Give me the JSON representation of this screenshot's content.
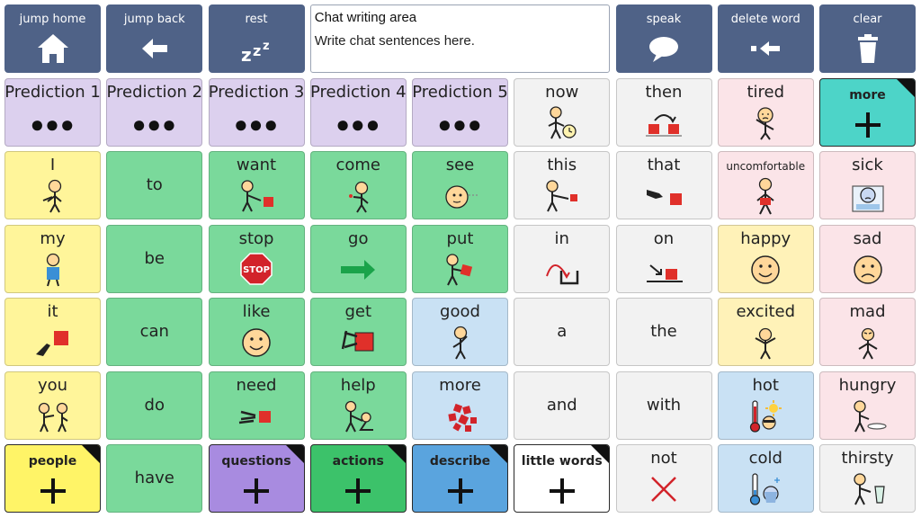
{
  "topbar": {
    "jump_home": "jump home",
    "jump_back": "jump back",
    "rest": "rest",
    "chat_title": "Chat writing area",
    "chat_placeholder": "Write chat sentences here.",
    "speak": "speak",
    "delete_word": "delete word",
    "clear": "clear"
  },
  "predictions": [
    "Prediction 1",
    "Prediction 2",
    "Prediction 3",
    "Prediction 4",
    "Prediction 5"
  ],
  "prediction_dots": "●●●",
  "words": {
    "now": "now",
    "then": "then",
    "tired": "tired",
    "more_top": "more",
    "I": "I",
    "to": "to",
    "want": "want",
    "come": "come",
    "see": "see",
    "this": "this",
    "that": "that",
    "uncomfortable": "uncomfortable",
    "sick": "sick",
    "my": "my",
    "be": "be",
    "stop": "stop",
    "go": "go",
    "put": "put",
    "in": "in",
    "on": "on",
    "happy": "happy",
    "sad": "sad",
    "it": "it",
    "can": "can",
    "like": "like",
    "get": "get",
    "good": "good",
    "a": "a",
    "the": "the",
    "excited": "excited",
    "mad": "mad",
    "you": "you",
    "do": "do",
    "need": "need",
    "help": "help",
    "more": "more",
    "and": "and",
    "with": "with",
    "hot": "hot",
    "hungry": "hungry",
    "people": "people",
    "have": "have",
    "questions": "questions",
    "actions": "actions",
    "describe": "describe",
    "little_words": "little words",
    "not": "not",
    "cold": "cold",
    "thirsty": "thirsty"
  },
  "stop_sign_text": "STOP",
  "colors": {
    "nav": "#4f6287",
    "prediction": "#dcd0ee",
    "pronoun": "#fff59a",
    "verb": "#7ad99b",
    "little_word": "#f2f2f2",
    "feeling_neg": "#fbe4e8",
    "feeling_pos": "#fff2b8",
    "describe": "#c9e1f4",
    "more_folder": "#4dd4c8"
  }
}
